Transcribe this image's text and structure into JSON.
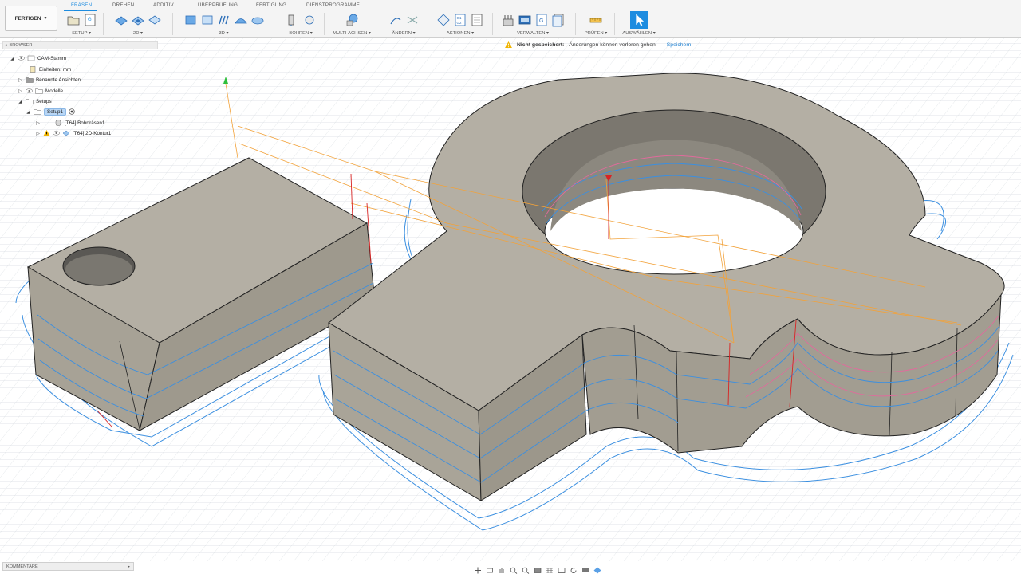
{
  "workspace": {
    "label": "FERTIGEN"
  },
  "tabs": [
    {
      "label": "FRÄSEN"
    },
    {
      "label": "DREHEN"
    },
    {
      "label": "ADDITIV"
    },
    {
      "label": "ÜBERPRÜFUNG"
    },
    {
      "label": "FERTIGUNG"
    },
    {
      "label": "DIENSTPROGRAMME"
    }
  ],
  "panels": {
    "setup": "SETUP",
    "twod": "2D",
    "threed": "3D",
    "bohren": "BOHREN",
    "multiachsen": "MULTI-ACHSEN",
    "aendern": "ÄNDERN",
    "aktionen": "AKTIONEN",
    "verwalten": "VERWALTEN",
    "pruefen": "PRÜFEN",
    "auswaehlen": "AUSWÄHLEN"
  },
  "icon_text": {
    "g": "G",
    "g1": "G1",
    "g2": "G2"
  },
  "notification": {
    "title": "Nicht gespeichert:",
    "message": "Änderungen können verloren gehen",
    "action": "Speichern"
  },
  "browser": {
    "title": "BROWSER",
    "items": [
      {
        "label": "CAM-Stamm"
      },
      {
        "label": "Einheiten: mm"
      },
      {
        "label": "Benannte Ansichten"
      },
      {
        "label": "Modelle"
      },
      {
        "label": "Setups"
      },
      {
        "label": "Setup1"
      },
      {
        "label": "[T64] Bohrfräsen1"
      },
      {
        "label": "[T64] 2D-Kontur1"
      }
    ]
  },
  "comments": {
    "label": "KOMMENTARE"
  },
  "colors": {
    "accent": "#1d8ce0",
    "part_top": "#b4afa4",
    "part_side": "#a49f93",
    "toolpath_blue": "#3b8fe0",
    "toolpath_pink": "#e06b9c",
    "rapid_orange": "#f2a23a",
    "plunge_red": "#d82424",
    "warning": "#f0b400"
  }
}
